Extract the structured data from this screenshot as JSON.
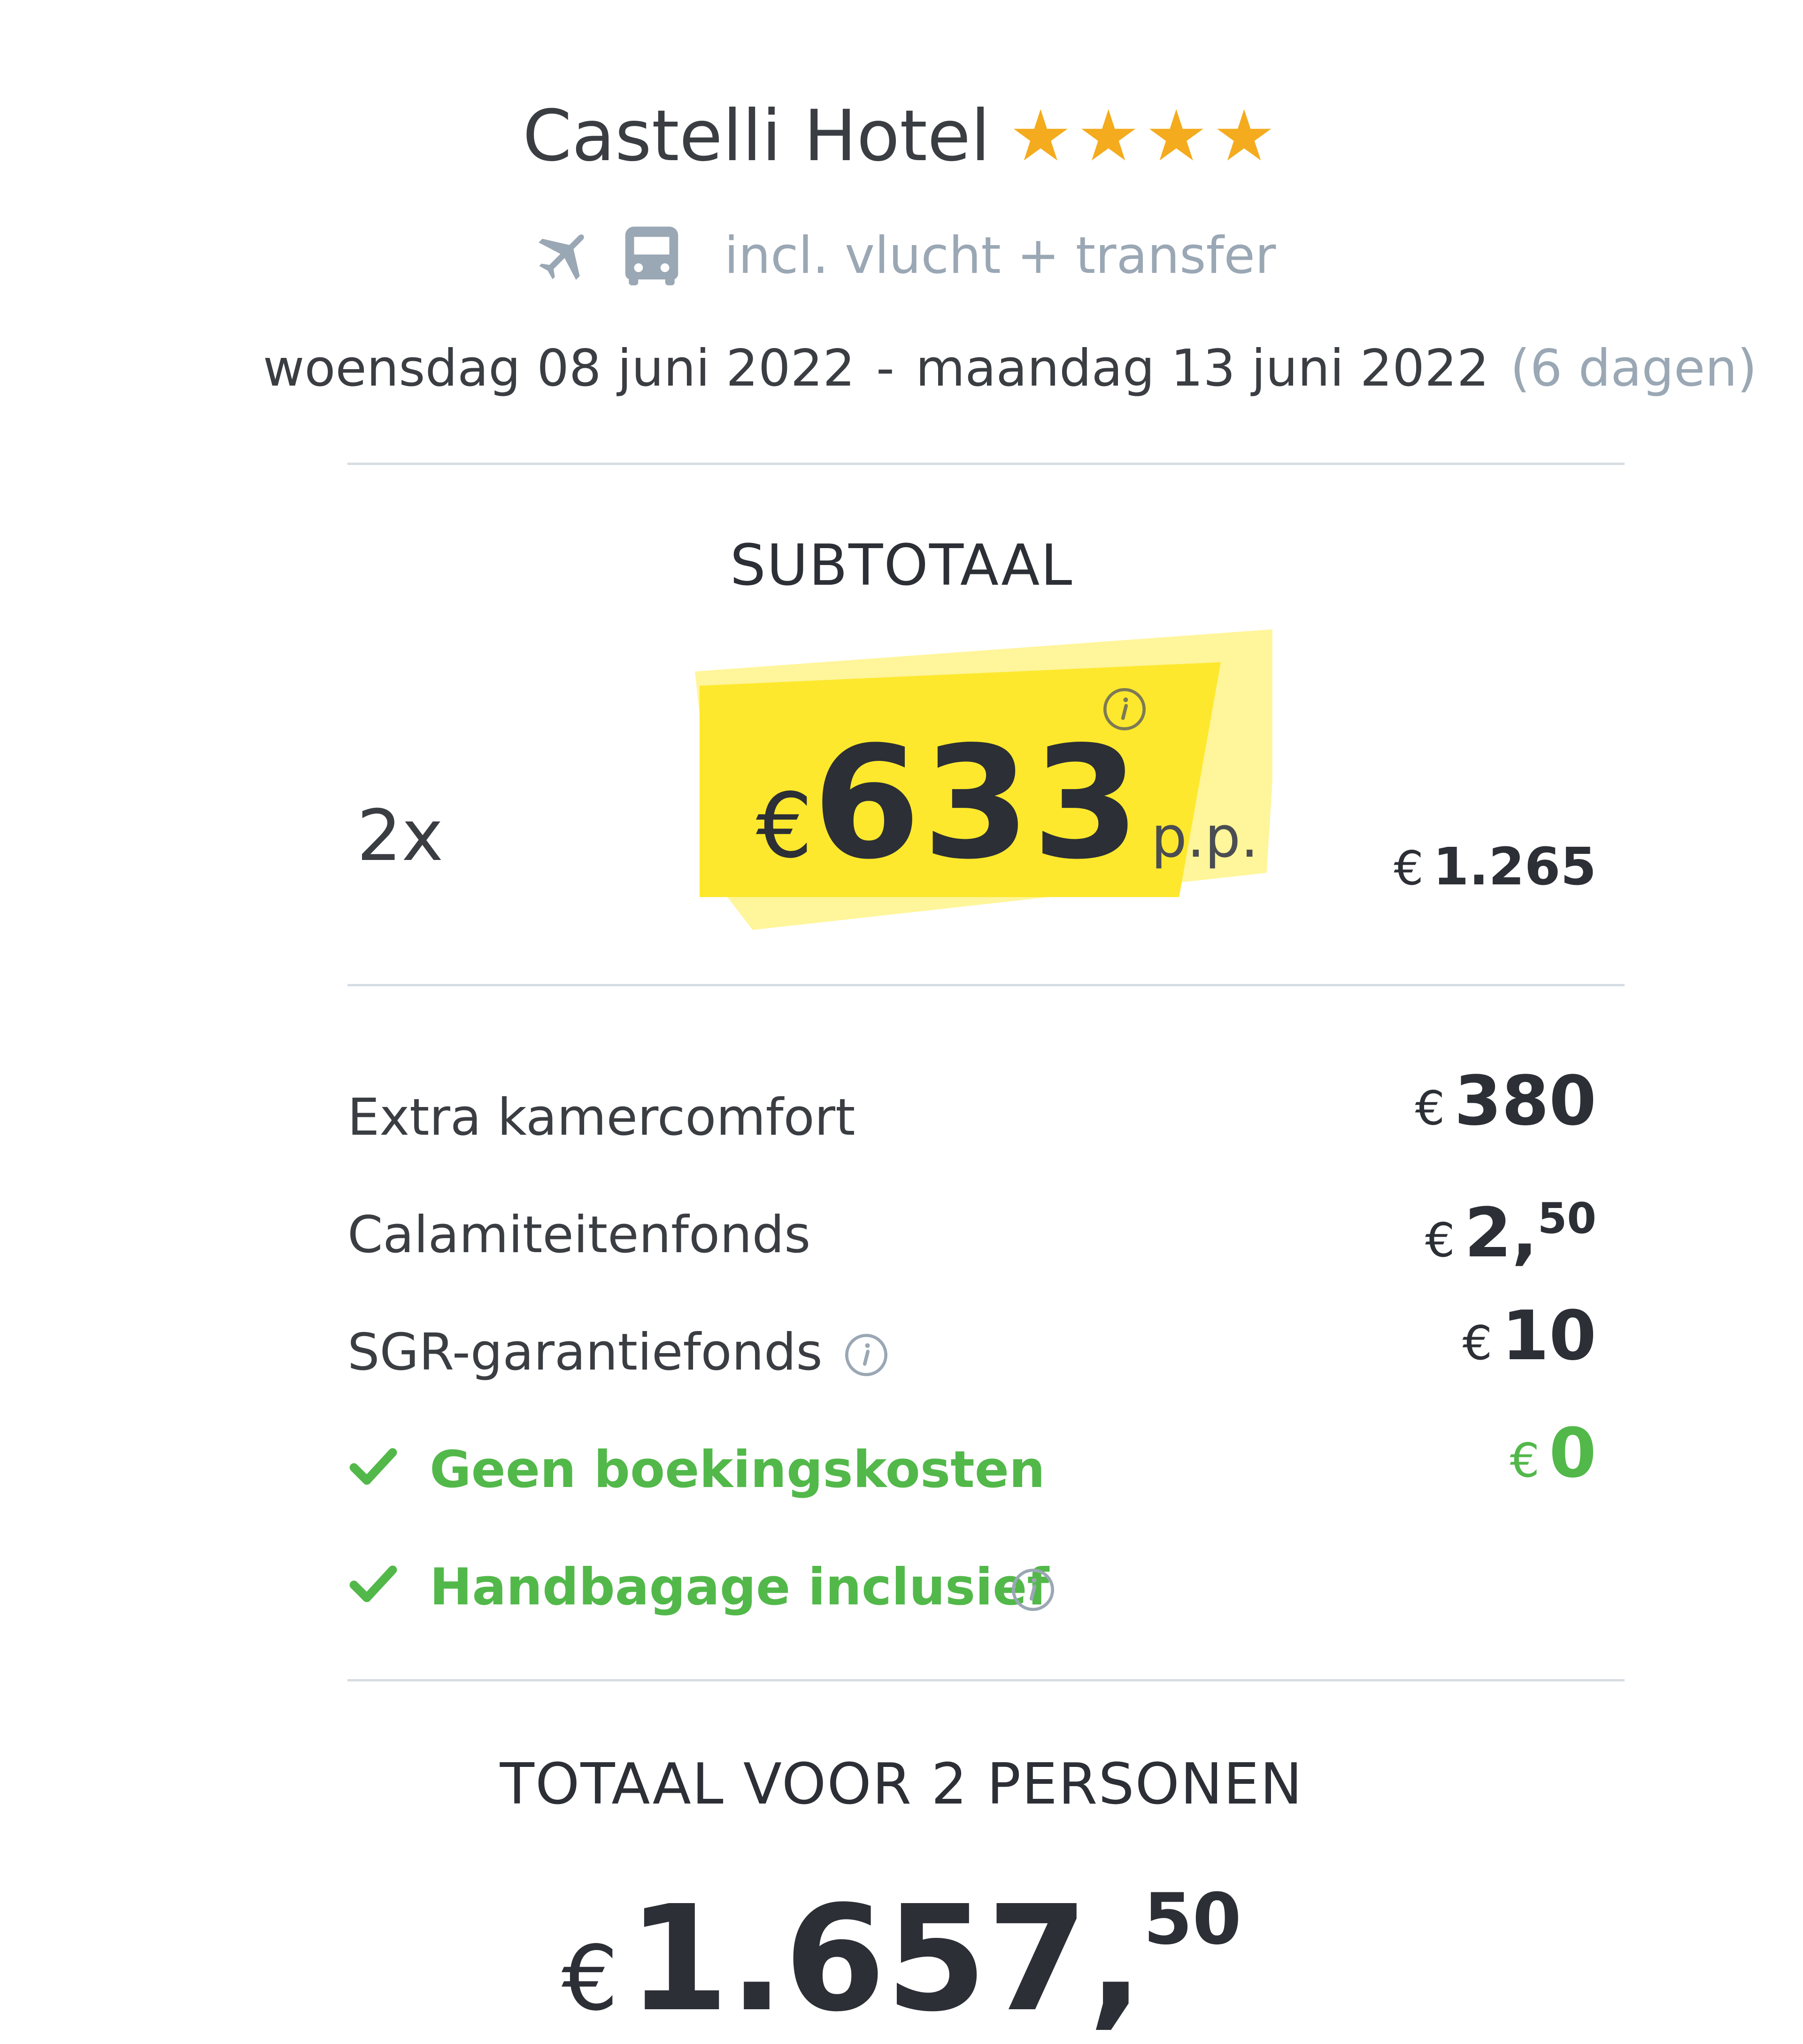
{
  "header": {
    "hotel_name": "Castelli Hotel",
    "star_rating": 4,
    "star_glyph": "★",
    "star_color": "#f4ab1d",
    "transport_icons": [
      "airplane-icon",
      "bus-icon"
    ],
    "includes_text": "incl. vlucht + transfer",
    "date_from": "woensdag 08 juni 2022",
    "date_separator": "-",
    "date_to": "maandag 13 juni 2022",
    "duration": "(6 dagen)"
  },
  "subtotal": {
    "heading": "SUBTOTAAL",
    "quantity": "2x",
    "currency": "€",
    "price_per_person": "633",
    "per_person_label": "p.p.",
    "highlight_color": "#fde82d",
    "total": "1.265"
  },
  "cost_lines": [
    {
      "label": "Extra kamercomfort",
      "currency": "€",
      "amount": "380",
      "decimals": ""
    },
    {
      "label": "Calamiteitenfonds",
      "currency": "€",
      "amount": "2,",
      "decimals": "50"
    },
    {
      "label": "SGR-garantiefonds",
      "currency": "€",
      "amount": "10",
      "decimals": "",
      "info_icon": "info-icon"
    }
  ],
  "included": [
    {
      "label": "Geen boekingskosten",
      "currency": "€",
      "amount": "0",
      "icon": "check-icon"
    },
    {
      "label": "Handbagage inclusief",
      "icon": "check-icon",
      "info_icon": "info-icon"
    }
  ],
  "accent_green": "#52b84a",
  "muted_color": "#9aa7b4",
  "total": {
    "heading": "TOTAAL VOOR 2 PERSONEN",
    "currency": "€",
    "amount": "1.657,",
    "decimals": "50"
  }
}
